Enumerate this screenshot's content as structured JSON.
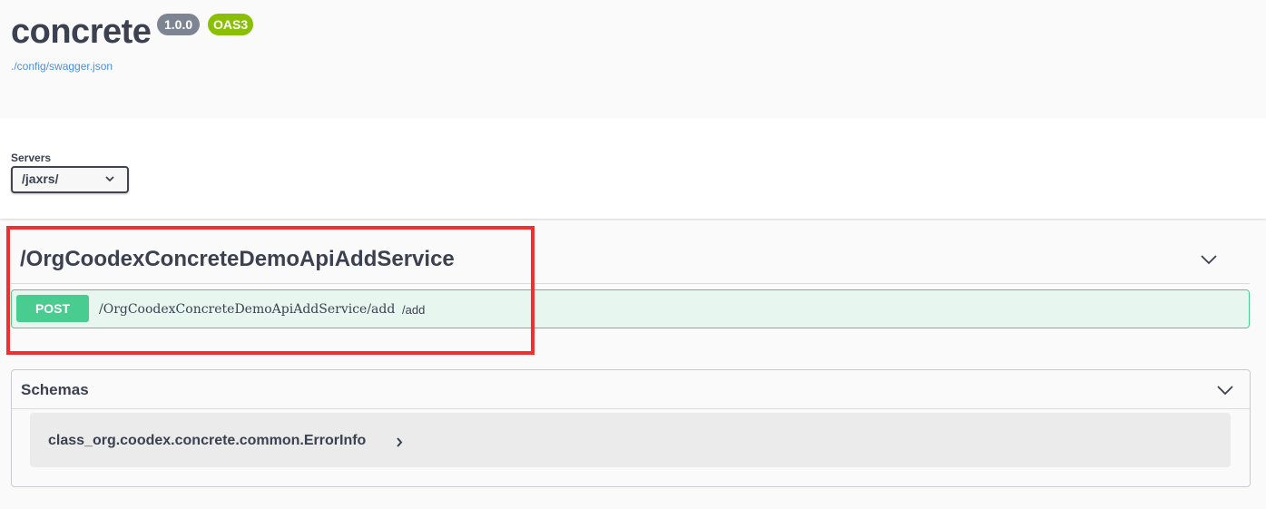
{
  "info": {
    "title": "concrete",
    "version": "1.0.0",
    "oas_badge": "OAS3",
    "spec_url": "./config/swagger.json"
  },
  "servers": {
    "label": "Servers",
    "selected": "/jaxrs/"
  },
  "tag": {
    "name": "/OrgCoodexConcreteDemoApiAddService",
    "operations": [
      {
        "method": "POST",
        "path": "/OrgCoodexConcreteDemoApiAddService/add",
        "summary": "/add"
      }
    ]
  },
  "schemas": {
    "title": "Schemas",
    "models": [
      {
        "name": "class_org.coodex.concrete.common.ErrorInfo"
      }
    ]
  },
  "colors": {
    "post": "#49cc90",
    "highlight": "#f03030",
    "version_badge": "#7d8492",
    "oas_badge": "#89bf04",
    "link": "#4990e2"
  },
  "icons": {
    "tag_toggle": "chevron-down-icon",
    "schemas_toggle": "chevron-down-icon",
    "model_expand": "chevron-right-icon",
    "select_caret": "chevron-down-icon"
  }
}
